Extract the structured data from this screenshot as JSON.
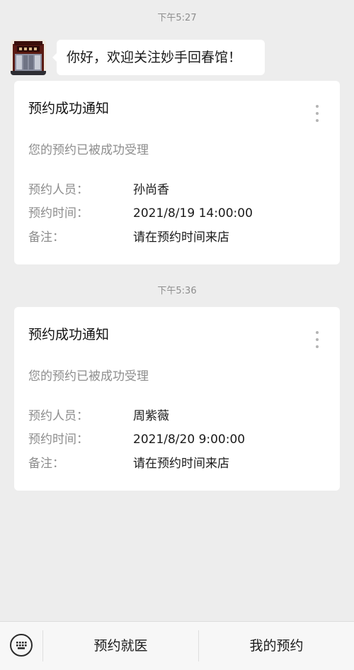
{
  "colors": {
    "background": "#ededed",
    "card": "#ffffff",
    "muted_text": "#8d8d8d",
    "primary_text": "#1a1a1a"
  },
  "chat": {
    "timestamps": [
      "下午5:27",
      "下午5:36"
    ],
    "welcome_message": "你好，欢迎关注妙手回春馆！",
    "avatar_icon": "shop-storefront-icon"
  },
  "cards": [
    {
      "title": "预约成功通知",
      "subtitle": "您的预约已被成功受理",
      "menu_icon": "more-vertical-icon",
      "fields": [
        {
          "label": "预约人员：",
          "value": "孙尚香"
        },
        {
          "label": "预约时间：",
          "value": "2021/8/19 14:00:00"
        },
        {
          "label": "备注：",
          "value": "请在预约时间来店"
        }
      ]
    },
    {
      "title": "预约成功通知",
      "subtitle": "您的预约已被成功受理",
      "menu_icon": "more-vertical-icon",
      "fields": [
        {
          "label": "预约人员：",
          "value": "周紫薇"
        },
        {
          "label": "预约时间：",
          "value": "2021/8/20 9:00:00"
        },
        {
          "label": "备注：",
          "value": "请在预约时间来店"
        }
      ]
    }
  ],
  "bottom_bar": {
    "keyboard_icon": "keyboard-icon",
    "menu_items": [
      "预约就医",
      "我的预约"
    ]
  }
}
